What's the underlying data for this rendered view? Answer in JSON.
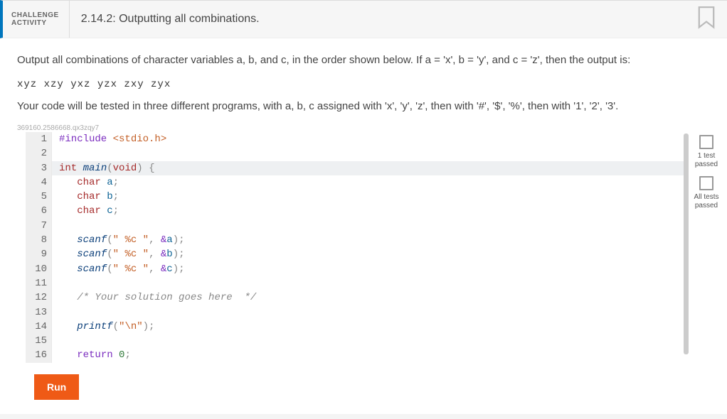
{
  "header": {
    "eyebrow_line1": "CHALLENGE",
    "eyebrow_line2": "ACTIVITY",
    "title": "2.14.2: Outputting all combinations."
  },
  "description": "Output all combinations of character variables a, b, and c, in the order shown below. If a = 'x', b = 'y', and c = 'z', then the output is:",
  "permutations": "xyz xzy yxz yzx zxy zyx",
  "description2": "Your code will be tested in three different programs, with a, b, c assigned with 'x', 'y', 'z', then with '#', '$', '%', then with '1', '2', '3'.",
  "hash": "369160.2586668.qx3zqy7",
  "code_lines": {
    "l1": "#include <stdio.h>",
    "l2": "",
    "l3": "int main(void) {",
    "l4": "   char a;",
    "l5": "   char b;",
    "l6": "   char c;",
    "l7": "",
    "l8": "   scanf(\" %c \", &a);",
    "l9": "   scanf(\" %c \", &b);",
    "l10": "   scanf(\" %c \", &c);",
    "l11": "",
    "l12": "   /* Your solution goes here  */",
    "l13": "",
    "l14": "   printf(\"\\n\");",
    "l15": "",
    "l16": "   return 0;"
  },
  "tests": {
    "t1": "1 test passed",
    "t2": "All tests passed"
  },
  "buttons": {
    "run": "Run"
  }
}
